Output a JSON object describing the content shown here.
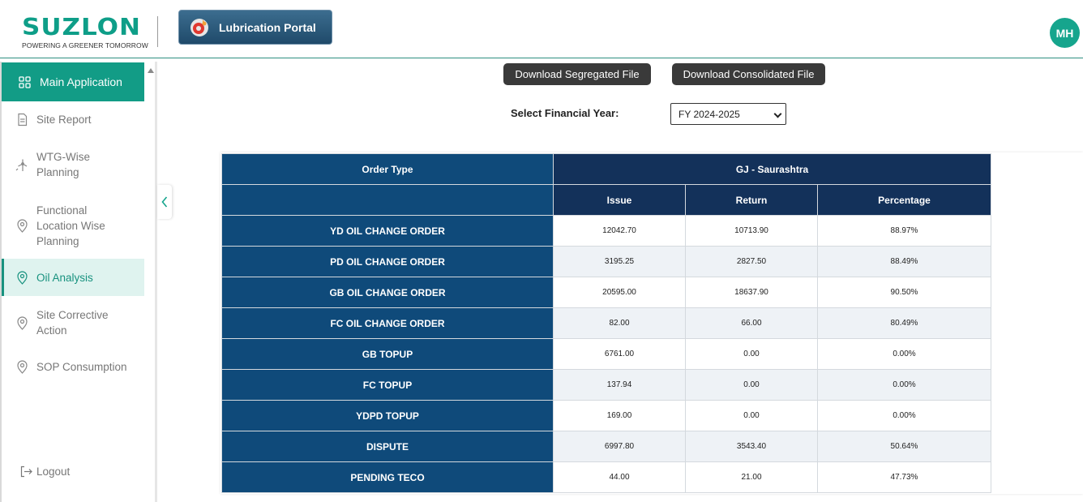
{
  "header": {
    "brand_name": "SUZLON",
    "brand_tagline": "POWERING A GREENER TOMORROW",
    "portal_label": "Lubrication Portal",
    "user_initials": "MH"
  },
  "sidebar": {
    "main_label": "Main Application",
    "items": [
      {
        "label": "Site Report",
        "icon": "document-icon"
      },
      {
        "label": "WTG-Wise Planning",
        "icon": "wind-turbine-icon"
      },
      {
        "label": "Functional Location Wise Planning",
        "icon": "location-pin-icon"
      },
      {
        "label": "Oil Analysis",
        "icon": "location-pin-icon",
        "active": true
      },
      {
        "label": "Site Corrective Action",
        "icon": "location-pin-icon"
      },
      {
        "label": "SOP Consumption",
        "icon": "location-pin-icon"
      }
    ],
    "logout_label": "Logout"
  },
  "toolbar": {
    "download_segregated": "Download Segregated File",
    "download_consolidated": "Download Consolidated File",
    "fy_label": "Select Financial Year:",
    "fy_value": "FY 2024-2025"
  },
  "table": {
    "order_type_header": "Order Type",
    "region_header": "GJ - Saurashtra",
    "columns": [
      "Issue",
      "Return",
      "Percentage"
    ],
    "rows": [
      {
        "type": "YD OIL CHANGE ORDER",
        "issue": "12042.70",
        "return": "10713.90",
        "pct": "88.97%"
      },
      {
        "type": "PD OIL CHANGE ORDER",
        "issue": "3195.25",
        "return": "2827.50",
        "pct": "88.49%"
      },
      {
        "type": "GB OIL CHANGE ORDER",
        "issue": "20595.00",
        "return": "18637.90",
        "pct": "90.50%"
      },
      {
        "type": "FC OIL CHANGE ORDER",
        "issue": "82.00",
        "return": "66.00",
        "pct": "80.49%"
      },
      {
        "type": "GB TOPUP",
        "issue": "6761.00",
        "return": "0.00",
        "pct": "0.00%"
      },
      {
        "type": "FC TOPUP",
        "issue": "137.94",
        "return": "0.00",
        "pct": "0.00%"
      },
      {
        "type": "YDPD TOPUP",
        "issue": "169.00",
        "return": "0.00",
        "pct": "0.00%"
      },
      {
        "type": "DISPUTE",
        "issue": "6997.80",
        "return": "3543.40",
        "pct": "50.64%"
      },
      {
        "type": "PENDING TECO",
        "issue": "44.00",
        "return": "21.00",
        "pct": "47.73%"
      }
    ]
  },
  "colors": {
    "brand_green": "#0e9e88",
    "header_navy": "#13315a",
    "row_header_blue": "#0f4a7a",
    "button_dark": "#3a3a3a"
  }
}
